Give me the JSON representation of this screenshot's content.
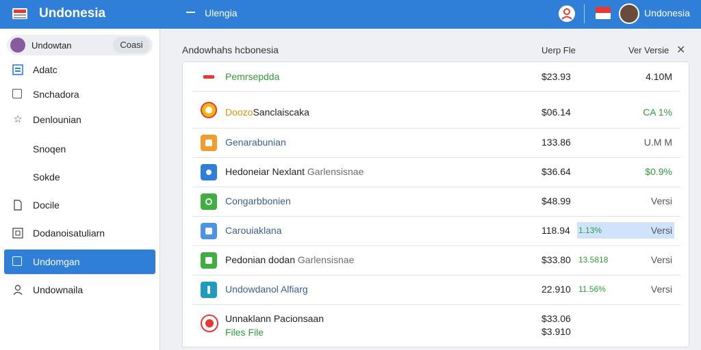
{
  "header": {
    "brand": "Undonesia",
    "tab": "Ulengia",
    "user": "Undonesia"
  },
  "sidebar": {
    "user": {
      "name": "Undowtan",
      "button": "Coasi"
    },
    "items": [
      {
        "label": "Adatc",
        "icon": "list-icon"
      },
      {
        "label": "Snchadora",
        "icon": "square-icon"
      },
      {
        "label": "Denlounian",
        "icon": "star-icon"
      },
      {
        "label": "Snoqen",
        "icon": ""
      },
      {
        "label": "Sokde",
        "icon": ""
      },
      {
        "label": "Docile",
        "icon": "document-icon"
      },
      {
        "label": "Dodanoisatuliarn",
        "icon": "box-icon"
      },
      {
        "label": "Undomgan",
        "icon": "box-icon",
        "active": true
      },
      {
        "label": "Undownaila",
        "icon": "user-icon"
      }
    ]
  },
  "main": {
    "title": "Andowhahs hcbonesia",
    "col_file": "Uerp Fle",
    "col_version": "Ver Versie",
    "rows": [
      {
        "name": "Pemrsepdda",
        "price": "$23.93",
        "extra": "",
        "version": "4.10M",
        "icon_color": "#e53935"
      },
      {
        "name_orange": "Doozo",
        "name": "Sanclaiscaka",
        "price": "$06.14",
        "extra": "",
        "version": "CA 1%",
        "icon_color": "#f5b80f"
      },
      {
        "name": "Genarabunian",
        "price": "133.86",
        "extra": "",
        "version": "U.M M",
        "icon_color": "#f29d2b"
      },
      {
        "name": "Hedoneiar Nexlant",
        "name_sub": "Garlensisnae",
        "price": "$36.64",
        "extra": "",
        "version": "$0.9%",
        "icon_color": "#2f7fd8"
      },
      {
        "name": "Congarbbonien",
        "price": "$48.99",
        "extra": "",
        "version": "Versi",
        "icon_color": "#3faf3f"
      },
      {
        "name": "Carouiaklana",
        "price": "118.94",
        "extra": "1.13%",
        "version": "Versi",
        "icon_color": "#4d94e6"
      },
      {
        "name": "Pedonian dodan",
        "name_sub": "Garlensisnae",
        "price": "$33.80",
        "extra": "13.5818",
        "version": "Versi",
        "icon_color": "#3faf3f"
      },
      {
        "name": "Undowdanol",
        "name_sub": "Alfiarg",
        "price": "22.910",
        "extra": "11.56%",
        "version": "Versi",
        "icon_color": "#1e9bbf"
      },
      {
        "name": "Unnaklann Pacionsaan",
        "name_sub": "Files File",
        "price": "$33.06",
        "price2": "$3.910",
        "extra": "",
        "version": "",
        "icon_color": "#e53935"
      }
    ]
  },
  "colors": {
    "accent": "#2f7fd8",
    "positive": "#2e9d3a",
    "highlight": "#cfe3fb"
  }
}
